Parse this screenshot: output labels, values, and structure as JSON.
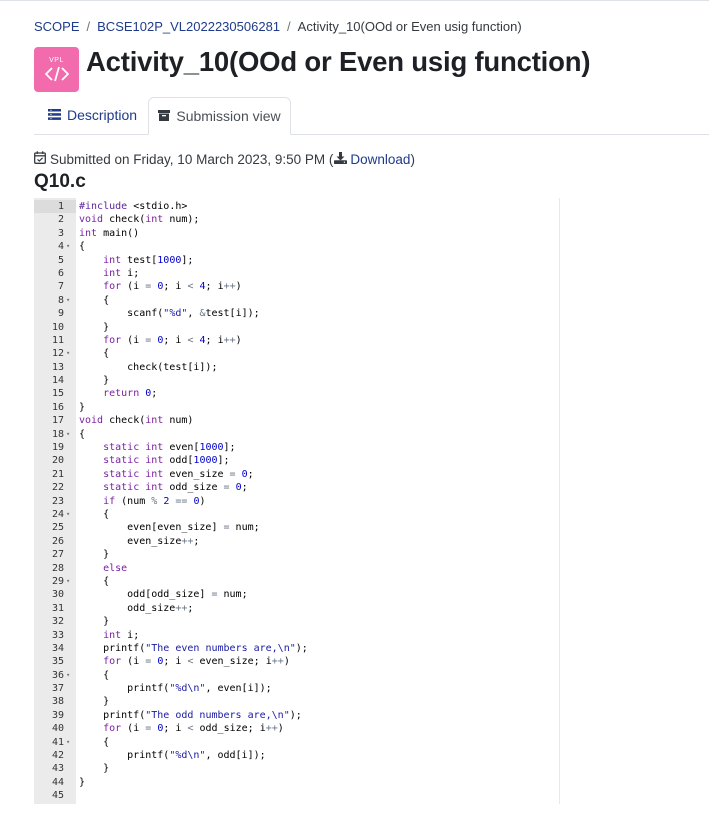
{
  "breadcrumb": {
    "items": [
      "SCOPE",
      "BCSE102P_VL2022230506281"
    ],
    "current": "Activity_10(OOd or Even usig function)",
    "separator": "/"
  },
  "activity_icon": {
    "text": "VPL",
    "color": "#f26bad"
  },
  "page_title": "Activity_10(OOd or Even usig function)",
  "tabs": [
    {
      "label": "Description",
      "icon": "list-icon",
      "active": false
    },
    {
      "label": "Submission view",
      "icon": "archive-icon",
      "active": true
    }
  ],
  "submission": {
    "submitted_text": "Submitted on Friday, 10 March 2023, 9:50 PM (",
    "download_label": "Download",
    "close_paren": ")"
  },
  "file_name": "Q10.c",
  "code_lines": [
    "#include <stdio.h>",
    "void check(int num);",
    "int main()",
    "{",
    "    int test[1000];",
    "    int i;",
    "    for (i = 0; i < 4; i++)",
    "    {",
    "        scanf(\"%d\", &test[i]);",
    "    }",
    "    for (i = 0; i < 4; i++)",
    "    {",
    "        check(test[i]);",
    "    }",
    "    return 0;",
    "}",
    "void check(int num)",
    "{",
    "    static int even[1000];",
    "    static int odd[1000];",
    "    static int even_size = 0;",
    "    static int odd_size = 0;",
    "    if (num % 2 == 0)",
    "    {",
    "        even[even_size] = num;",
    "        even_size++;",
    "    }",
    "    else",
    "    {",
    "        odd[odd_size] = num;",
    "        odd_size++;",
    "    }",
    "    int i;",
    "    printf(\"The even numbers are,\\n\");",
    "    for (i = 0; i < even_size; i++)",
    "    {",
    "        printf(\"%d\\n\", even[i]);",
    "    }",
    "    printf(\"The odd numbers are,\\n\");",
    "    for (i = 0; i < odd_size; i++)",
    "    {",
    "        printf(\"%d\\n\", odd[i]);",
    "    }",
    "}",
    ""
  ],
  "fold_lines": [
    4,
    8,
    12,
    18,
    24,
    29,
    36,
    41
  ],
  "highlighted_line": 1,
  "colors": {
    "link": "#1f3b8a",
    "vpl_pink": "#f26bad",
    "gutter": "#ebebeb",
    "keyword": "#7a1fa2",
    "string": "#1a1aa6"
  }
}
